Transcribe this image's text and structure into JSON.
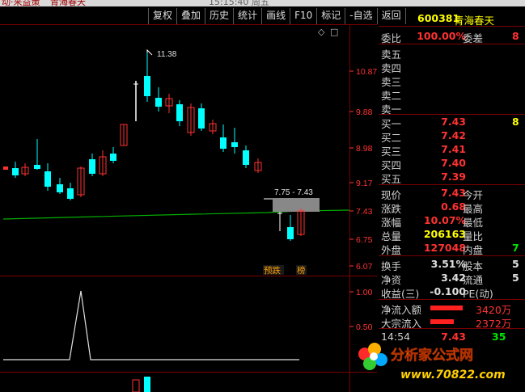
{
  "titlebar": {
    "left_text": "动·来益策",
    "stock_name_top": "青海春天",
    "time_text": "15:15:40  周五"
  },
  "toolbar": [
    {
      "label": "复权"
    },
    {
      "label": "叠加"
    },
    {
      "label": "历史"
    },
    {
      "label": "统计"
    },
    {
      "label": "画线"
    },
    {
      "label": "F10"
    },
    {
      "label": "标记"
    },
    {
      "label": "-自选"
    },
    {
      "label": "返回"
    }
  ],
  "chart_icons": {
    "diamond": "◇",
    "close": "□"
  },
  "price_axis": {
    "labels": [
      "10.87",
      "9.88",
      "8.98",
      "9.17",
      "7.43",
      "6.75",
      "6.07"
    ],
    "indicator_labels": [
      "1.00",
      "0.50"
    ]
  },
  "annotations": {
    "high": "11.38",
    "range_box": "7.75 - 7.43",
    "tag_yudie": "预跌",
    "tag_bang": "榜"
  },
  "colors": {
    "up": "#ff3232",
    "down": "#00ffff",
    "ma_line": "#00b000",
    "grid": "#7a0000",
    "panel_text": "#d0d0d0"
  },
  "quote": {
    "code": "600381",
    "name": "青海春天",
    "weibi_label": "委比",
    "weibi_value": "100.00%",
    "weicha_label": "委差",
    "weicha_value": "8",
    "sell_labels": [
      "卖五",
      "卖四",
      "卖三",
      "卖二",
      "卖一"
    ],
    "buy": [
      {
        "label": "买一",
        "price": "7.43",
        "vol": "8"
      },
      {
        "label": "买二",
        "price": "7.42",
        "vol": ""
      },
      {
        "label": "买三",
        "price": "7.41",
        "vol": ""
      },
      {
        "label": "买四",
        "price": "7.40",
        "vol": ""
      },
      {
        "label": "买五",
        "price": "7.39",
        "vol": ""
      }
    ],
    "stats": [
      {
        "l1": "现价",
        "v1": "7.43",
        "l2": "今开",
        "v2": ""
      },
      {
        "l1": "涨跌",
        "v1": "0.68",
        "l2": "最高",
        "v2": ""
      },
      {
        "l1": "涨幅",
        "v1": "10.07%",
        "l2": "最低",
        "v2": ""
      },
      {
        "l1": "总量",
        "v1": "206163",
        "l2": "量比",
        "v2": ""
      },
      {
        "l1": "外盘",
        "v1": "127048",
        "l2": "内盘",
        "v2": "7"
      }
    ],
    "stats2": [
      {
        "l1": "换手",
        "v1": "3.51%",
        "l2": "股本",
        "v2": "5"
      },
      {
        "l1": "净资",
        "v1": "3.42",
        "l2": "流通",
        "v2": "5"
      },
      {
        "l1": "收益(三)",
        "v1": "-0.100",
        "l2": "PE(动)",
        "v2": ""
      }
    ],
    "flow": [
      {
        "label": "净流入额",
        "value": "3420万",
        "bar_pct": 0.83
      },
      {
        "label": "大宗流入",
        "value": "2372万",
        "bar_pct": 0.6
      }
    ],
    "tick": {
      "time": "14:54",
      "price": "7.43",
      "vol": "35"
    }
  },
  "logo": {
    "line1": "分析家公式网",
    "line2": "www.70822.com"
  }
}
